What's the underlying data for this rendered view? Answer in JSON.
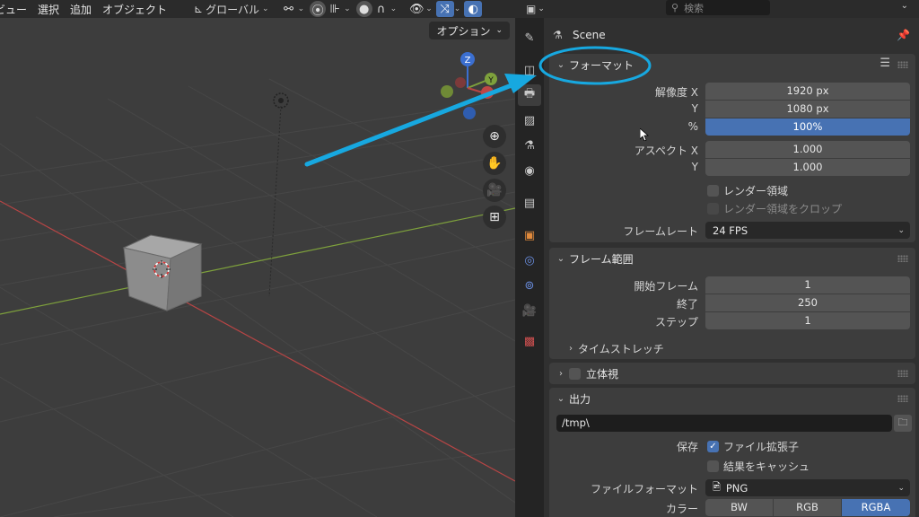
{
  "viewport": {
    "menu": [
      "ビュー",
      "選択",
      "追加",
      "オブジェクト"
    ],
    "transform_orientation": "グローバル",
    "options_label": "オプション",
    "gizmo": {
      "z": "Z",
      "y": "Y"
    }
  },
  "properties": {
    "search_placeholder": "検索",
    "scene_name": "Scene",
    "format_panel": {
      "title": "フォーマット",
      "resolution_x_label": "解像度 X",
      "resolution_x": "1920 px",
      "resolution_y_label": "Y",
      "resolution_y": "1080 px",
      "percent_label": "%",
      "percent": "100%",
      "aspect_x_label": "アスペクト X",
      "aspect_x": "1.000",
      "aspect_y_label": "Y",
      "aspect_y": "1.000",
      "render_region": "レンダー領域",
      "crop_region": "レンダー領域をクロップ",
      "frame_rate_label": "フレームレート",
      "frame_rate": "24 FPS"
    },
    "frame_range_panel": {
      "title": "フレーム範囲",
      "start_label": "開始フレーム",
      "start": "1",
      "end_label": "終了",
      "end": "250",
      "step_label": "ステップ",
      "step": "1",
      "time_stretch": "タイムストレッチ"
    },
    "stereo_panel": {
      "title": "立体視"
    },
    "output_panel": {
      "title": "出力",
      "path": "/tmp\\",
      "save_label": "保存",
      "file_extensions": "ファイル拡張子",
      "cache_result": "結果をキャッシュ",
      "file_format_label": "ファイルフォーマット",
      "file_format": "PNG",
      "color_label": "カラー",
      "color_modes": [
        "BW",
        "RGB",
        "RGBA"
      ],
      "color_selected": "RGBA"
    }
  },
  "colors": {
    "accent": "#4772b3",
    "annotation": "#17a8e0",
    "axis_x": "#b84545",
    "axis_y": "#7ea13c"
  }
}
